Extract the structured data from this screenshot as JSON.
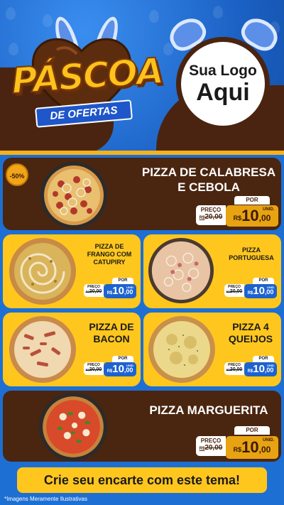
{
  "header": {
    "title": "PÁSCOA",
    "subtitle": "DE OFERTAS",
    "logo_line1": "Sua Logo",
    "logo_line2": "Aqui"
  },
  "badge": "-50%",
  "items": [
    {
      "name_line1": "PIZZA DE CALABRESA",
      "name_line2": "E CEBOLA",
      "por": "POR",
      "preco_label": "PREÇO",
      "old_currency": "R$",
      "old_price": "20,00",
      "currency": "R$",
      "new_int": "10",
      "new_dec": ",00",
      "unit": "UNID."
    },
    {
      "name_line1": "PIZZA DE",
      "name_line2": "FRANGO COM",
      "name_line3": "CATUPIRY",
      "por": "POR",
      "preco_label": "PREÇO",
      "old_currency": "R$",
      "old_price": "20,00",
      "currency": "R$",
      "new_int": "10",
      "new_dec": ",00",
      "unit": "UNID."
    },
    {
      "name_line1": "PIZZA",
      "name_line2": "PORTUGUESA",
      "por": "POR",
      "preco_label": "PREÇO",
      "old_currency": "R$",
      "old_price": "20,00",
      "currency": "R$",
      "new_int": "10",
      "new_dec": ",00",
      "unit": "UNID."
    },
    {
      "name_line1": "PIZZA DE",
      "name_line2": "BACON",
      "por": "POR",
      "preco_label": "PREÇO",
      "old_currency": "R$",
      "old_price": "20,00",
      "currency": "R$",
      "new_int": "10",
      "new_dec": ",00",
      "unit": "UNID."
    },
    {
      "name_line1": "PIZZA 4",
      "name_line2": "QUEIJOS",
      "por": "POR",
      "preco_label": "PREÇO",
      "old_currency": "R$",
      "old_price": "20,00",
      "currency": "R$",
      "new_int": "10",
      "new_dec": ",00",
      "unit": "UNID."
    },
    {
      "name_line1": "PIZZA MARGUERITA",
      "por": "POR",
      "preco_label": "PREÇO",
      "old_currency": "R$",
      "old_price": "20,00",
      "currency": "R$",
      "new_int": "10",
      "new_dec": ",00",
      "unit": "UNID."
    }
  ],
  "cta": "Crie seu encarte com este tema!",
  "footnote": "*Imagens Meramente Ilustrativas",
  "colors": {
    "brown": "#4a2510",
    "yellow": "#ffc71e",
    "blue": "#1d6fd3",
    "price_blue": "#1d63d0",
    "price_gold": "#e7a312"
  }
}
